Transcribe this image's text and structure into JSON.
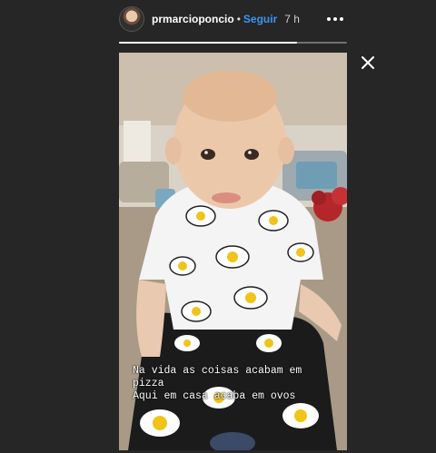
{
  "header": {
    "username": "prmarcioponcio",
    "separator": "•",
    "follow_label": "Seguir",
    "time_ago": "7 h"
  },
  "icons": {
    "avatar": "profile-avatar",
    "more": "more-options-icon",
    "close": "close-icon"
  },
  "progress": {
    "fraction": 0.78
  },
  "story": {
    "caption_lines": [
      "Na vida as coisas acabam em",
      "pizza",
      "Aqui em casa acaba em ovos"
    ]
  },
  "colors": {
    "background": "#262626",
    "follow": "#3897f0",
    "text": "#ffffff"
  }
}
